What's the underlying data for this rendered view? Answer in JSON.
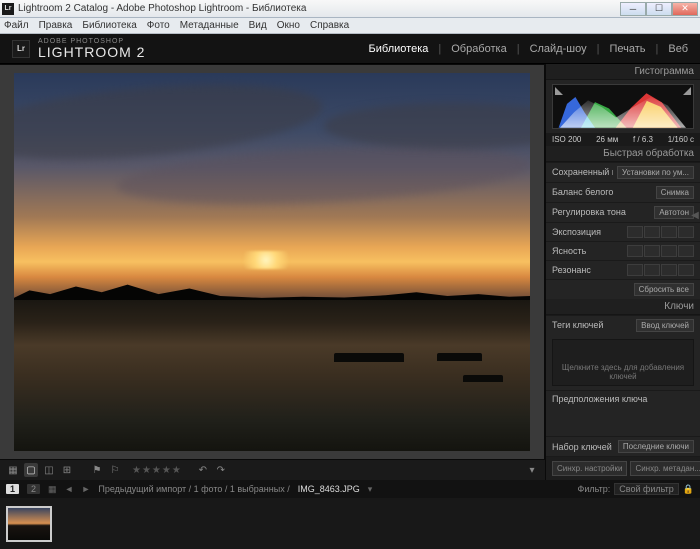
{
  "window": {
    "title": "Lightroom 2 Catalog - Adobe Photoshop Lightroom - Библиотека"
  },
  "os_menu": [
    "Файл",
    "Правка",
    "Библиотека",
    "Фото",
    "Метаданные",
    "Вид",
    "Окно",
    "Справка"
  ],
  "brand": {
    "sup": "ADOBE PHOTOSHOP",
    "main": "LIGHTROOM 2"
  },
  "modules": [
    {
      "label": "Библиотека",
      "active": true
    },
    {
      "label": "Обработка",
      "active": false
    },
    {
      "label": "Слайд-шоу",
      "active": false
    },
    {
      "label": "Печать",
      "active": false
    },
    {
      "label": "Веб",
      "active": false
    }
  ],
  "panels": {
    "histogram": {
      "title": "Гистограмма",
      "exif": {
        "iso": "ISO 200",
        "focal": "26 мм",
        "aperture": "f / 6.3",
        "shutter": "1/160 с"
      }
    },
    "quickdev": {
      "title": "Быстрая обработка",
      "preset_label": "Сохраненный пресет",
      "preset_value": "Установки по ум...",
      "wb_label": "Баланс белого",
      "wb_value": "Снимка",
      "tone_label": "Регулировка тона",
      "autotone": "Автотон",
      "exposure": "Экспозиция",
      "clarity": "Ясность",
      "vibrance": "Резонанс",
      "reset": "Сбросить все"
    },
    "keywords": {
      "title": "Ключи",
      "tags_label": "Теги ключей",
      "tags_value": "Ввод ключей",
      "hint": "Щелкните здесь для добавления ключей",
      "suggestions": "Предположения ключа",
      "keyset_label": "Набор ключей",
      "keyset_value": "Последние ключи"
    }
  },
  "sync": {
    "settings": "Синхр. настройки",
    "metadata": "Синхр. метадан..."
  },
  "infobar": {
    "count1": "1",
    "count2": "2",
    "crumb": "Предыдущий импорт / 1 фото / 1 выбранных /",
    "filename": "IMG_8463.JPG",
    "filter_label": "Фильтр:",
    "filter_value": "Свой фильтр"
  }
}
